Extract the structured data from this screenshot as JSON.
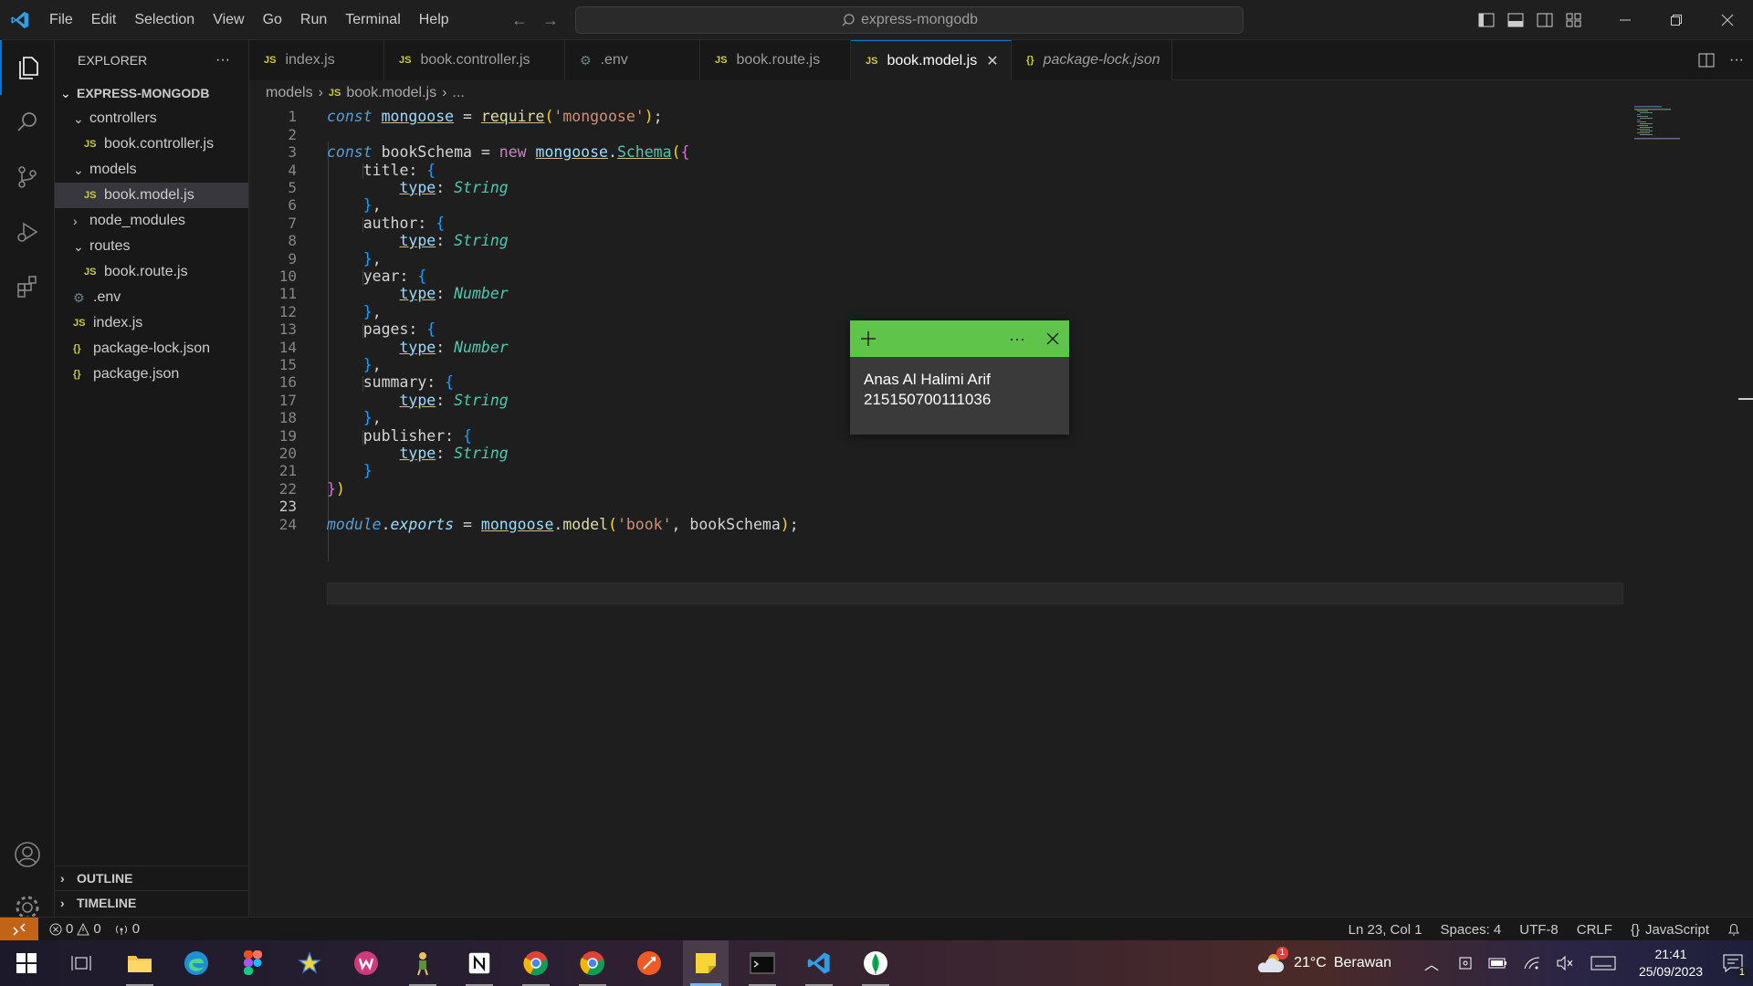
{
  "titlebar": {
    "menu": [
      "File",
      "Edit",
      "Selection",
      "View",
      "Go",
      "Run",
      "Terminal",
      "Help"
    ],
    "command_center": "express-mongodb"
  },
  "sidebar": {
    "title": "EXPLORER",
    "more": "···",
    "project": "EXPRESS-MONGODB",
    "tree": [
      {
        "label": "controllers",
        "icon": "",
        "kind": "folder-open"
      },
      {
        "label": "book.controller.js",
        "icon": "JS",
        "kind": "file"
      },
      {
        "label": "models",
        "icon": "",
        "kind": "folder-open"
      },
      {
        "label": "book.model.js",
        "icon": "JS",
        "kind": "file"
      },
      {
        "label": "node_modules",
        "icon": "",
        "kind": "folder-closed"
      },
      {
        "label": "routes",
        "icon": "",
        "kind": "folder-open"
      },
      {
        "label": "book.route.js",
        "icon": "JS",
        "kind": "file"
      },
      {
        "label": ".env",
        "icon": "⚙",
        "kind": "file"
      },
      {
        "label": "index.js",
        "icon": "JS",
        "kind": "file"
      },
      {
        "label": "package-lock.json",
        "icon": "{}",
        "kind": "file"
      },
      {
        "label": "package.json",
        "icon": "{}",
        "kind": "file"
      }
    ],
    "outline": "OUTLINE",
    "timeline": "TIMELINE"
  },
  "tabs": [
    {
      "label": "index.js",
      "icon": "JS"
    },
    {
      "label": "book.controller.js",
      "icon": "JS"
    },
    {
      "label": ".env",
      "icon": "⚙"
    },
    {
      "label": "book.route.js",
      "icon": "JS"
    },
    {
      "label": "book.model.js",
      "icon": "JS",
      "active": true
    },
    {
      "label": "package-lock.json",
      "icon": "{}"
    }
  ],
  "breadcrumb": {
    "folder": "models",
    "icon": "JS",
    "file": "book.model.js",
    "tail": "..."
  },
  "editor": {
    "current_line": 23,
    "line_numbers": [
      "1",
      "2",
      "3",
      "4",
      "5",
      "6",
      "7",
      "8",
      "9",
      "10",
      "11",
      "12",
      "13",
      "14",
      "15",
      "16",
      "17",
      "18",
      "19",
      "20",
      "21",
      "22",
      "23",
      "24"
    ],
    "code": {
      "l1": {
        "const": "const",
        "mongoose": "mongoose",
        "eq": " = ",
        "require": "require",
        "open": "(",
        "arg": "'mongoose'",
        "close": ");"
      },
      "l3": {
        "const": "const",
        "name": " bookSchema",
        "eq": " = ",
        "new": "new",
        "mongoose": "mongoose",
        "dot": ".",
        "schema": "Schema",
        "open": "(",
        "brace": "{"
      },
      "fields": [
        {
          "key": "title",
          "type": "String"
        },
        {
          "key": "author",
          "type": "String"
        },
        {
          "key": "year",
          "type": "Number"
        },
        {
          "key": "pages",
          "type": "Number"
        },
        {
          "key": "summary",
          "type": "String"
        },
        {
          "key": "publisher",
          "type": "String"
        }
      ],
      "type_key": "type",
      "l22": "})",
      "l24": {
        "module": "module",
        "dot1": ".",
        "exports": "exports",
        "eq": " = ",
        "mongoose": "mongoose",
        "dot2": ".",
        "model": "model",
        "open": "(",
        "arg1": "'book'",
        "sep": ", bookSchema",
        "close": ");"
      }
    }
  },
  "sticky_note": {
    "line1": "Anas Al Halimi Arif",
    "line2": "215150700111036",
    "color": "#5fc44a"
  },
  "statusbar": {
    "errors": "0",
    "warnings": "0",
    "ports": "0",
    "position": "Ln 23, Col 1",
    "spaces": "Spaces: 4",
    "encoding": "UTF-8",
    "eol": "CRLF",
    "language": "JavaScript"
  },
  "taskbar": {
    "weather_temp": "21°C",
    "weather_text": "Berawan",
    "weather_badge": "1",
    "time": "21:41",
    "date": "25/09/2023",
    "notification_count": "1"
  },
  "colors": {
    "accent": "#0078d4",
    "remote": "#c26418",
    "js_icon": "#cbcb41"
  }
}
